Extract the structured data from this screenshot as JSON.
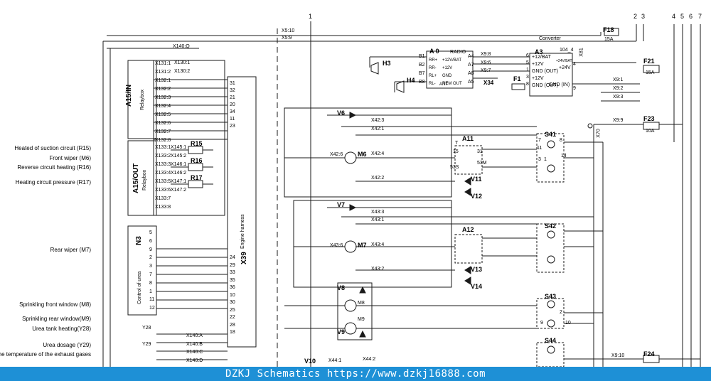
{
  "footer": "DZKJ Schematics https://www.dzkj16888.com",
  "side_labels": [
    "Heated of suction circuit (R15)",
    "Front wiper (M6)",
    "Reverse circuit heating (R16)",
    "Heating circuit pressure (R17)",
    "Rear wiper (M7)",
    "Sprinkling front window (M8)",
    "Sprinkling rear window(M9)",
    "Urea tank heating(Y28)",
    "Urea dosage (Y29)",
    "The temperature of the exhaust gases"
  ],
  "top_numbers": [
    "1",
    "2",
    "3",
    "4",
    "5",
    "6",
    "7"
  ],
  "fuses": [
    {
      "name": "F18",
      "rating": "15A"
    },
    {
      "name": "F21",
      "rating": "15A"
    },
    {
      "name": "F23",
      "rating": "10A"
    },
    {
      "name": "F24",
      "rating": ""
    },
    {
      "name": "F1",
      "rating": ""
    }
  ],
  "connector_labels": {
    "x5_10": "X5:10",
    "x5_9": "X5:9",
    "x140_q": "X140:Q",
    "converter": "Converter",
    "x9_8": "X9:8",
    "x9_6": "X9:6",
    "x9_7": "X9:7",
    "x9_1": "X9:1",
    "x9_2": "X9:2",
    "x9_3": "X9:3",
    "x9_9": "X9:9",
    "x9_10": "X9:10",
    "x70": "X70",
    "x81": "X81",
    "x34": "X34"
  },
  "relaybox_in": {
    "title": "A15/IN",
    "subtitle": "Relaybox",
    "pins": [
      "X131:1",
      "X131:2",
      "X132:1",
      "X132:2",
      "X132:3",
      "X132:4",
      "X132:5",
      "X132:6",
      "X132:7",
      "X132:8"
    ],
    "x130": [
      "X130:1",
      "X130:2"
    ]
  },
  "relaybox_out": {
    "title": "A15/OUT",
    "subtitle": "Relaybox",
    "pins": [
      "X133:1",
      "X133:2",
      "X133:3",
      "X133:4",
      "X133:5",
      "X133:6",
      "X133:7",
      "X133:8"
    ],
    "x14x": [
      "X145:1",
      "X145:2",
      "X146:1",
      "X146:2",
      "X147:1",
      "X147:2"
    ],
    "resistors": [
      "R15",
      "R16",
      "R17"
    ]
  },
  "harness": {
    "label": "Engine harness",
    "id": "X39",
    "pins": [
      "31",
      "32",
      "21",
      "20",
      "34",
      "11",
      "23",
      "24",
      "29",
      "33",
      "35",
      "36",
      "10",
      "30",
      "25",
      "22",
      "28",
      "18"
    ]
  },
  "n3": {
    "title": "N3",
    "subtitle": "Control of urea",
    "pins": [
      "5",
      "6",
      "9",
      "2",
      "3",
      "7",
      "8",
      "1",
      "11",
      "12"
    ]
  },
  "a0": {
    "title": "A 0",
    "radio": "RADIO",
    "left_pins": [
      "B1",
      "B2",
      "B7",
      "B8"
    ],
    "right_pins": [
      "A4",
      "A7",
      "A8",
      "A5"
    ],
    "signals": [
      "RR+",
      "RR-",
      "RL+",
      "RL-",
      "+12V/BAT",
      "+12V",
      "GND",
      "REM OUT",
      "ANT"
    ]
  },
  "a3": {
    "title": "A3",
    "code": "104_4",
    "pins": [
      "6",
      "5",
      "1",
      "3",
      "8",
      "4",
      "9"
    ],
    "signals": [
      "+12/BAT",
      "+12V",
      "GND (OUT)",
      "+12V",
      "GND (OUT)",
      "+24V/BAT",
      "+24V",
      "GND (IN)"
    ]
  },
  "speakers": [
    "H3",
    "H4"
  ],
  "motors": [
    {
      "name": "M6",
      "conn": "X42:6",
      "wires": [
        "X42:3",
        "X42:1",
        "X42:4",
        "X42:2"
      ],
      "relay": "A11",
      "diodes": [
        "V6",
        "V11",
        "V12"
      ],
      "switch": "S41"
    },
    {
      "name": "M7",
      "conn": "X43:6",
      "wires": [
        "X43:3",
        "X43:1",
        "X43:4",
        "X43:2"
      ],
      "relay": "A12",
      "diodes": [
        "V7",
        "V13",
        "V14"
      ],
      "switch": "S42"
    }
  ],
  "relay_pins": [
    "T",
    "15",
    "31",
    "53S",
    "53M"
  ],
  "switch_pins": [
    "7",
    "8",
    "11",
    "3",
    "14",
    "1",
    "2",
    "9",
    "10"
  ],
  "pumps": [
    "M8",
    "M9"
  ],
  "pump_diodes": [
    "V8",
    "V9",
    "V10"
  ],
  "switches_low": [
    "S43",
    "S44"
  ],
  "x44": "X44:2",
  "x44_1": "X44:1",
  "urea_parts": [
    "Y28",
    "Y29",
    "X140:A",
    "X140:B",
    "X140:C",
    "X140:D"
  ]
}
